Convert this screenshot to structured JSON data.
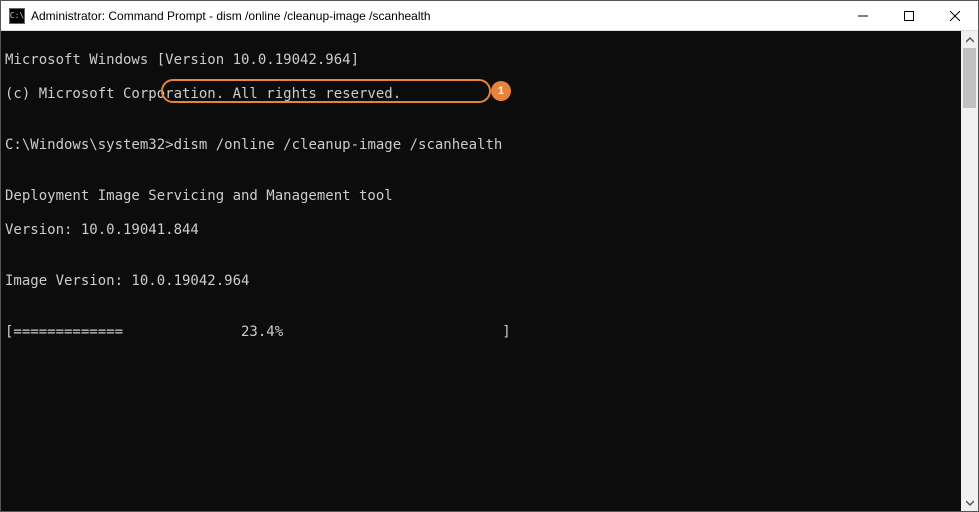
{
  "titlebar": {
    "icon_label": "C:\\",
    "title": "Administrator: Command Prompt - dism  /online /cleanup-image /scanhealth"
  },
  "terminal": {
    "line1": "Microsoft Windows [Version 10.0.19042.964]",
    "line2": "(c) Microsoft Corporation. All rights reserved.",
    "blank1": "",
    "prompt_prefix": "C:\\Windows\\system32>",
    "command": "dism /online /cleanup-image /scanhealth",
    "blank2": "",
    "line3": "Deployment Image Servicing and Management tool",
    "line4": "Version: 10.0.19041.844",
    "blank3": "",
    "line5": "Image Version: 10.0.19042.964",
    "blank4": "",
    "progress": "[=============              23.4%                          ]"
  },
  "annotation": {
    "badge": "1"
  }
}
